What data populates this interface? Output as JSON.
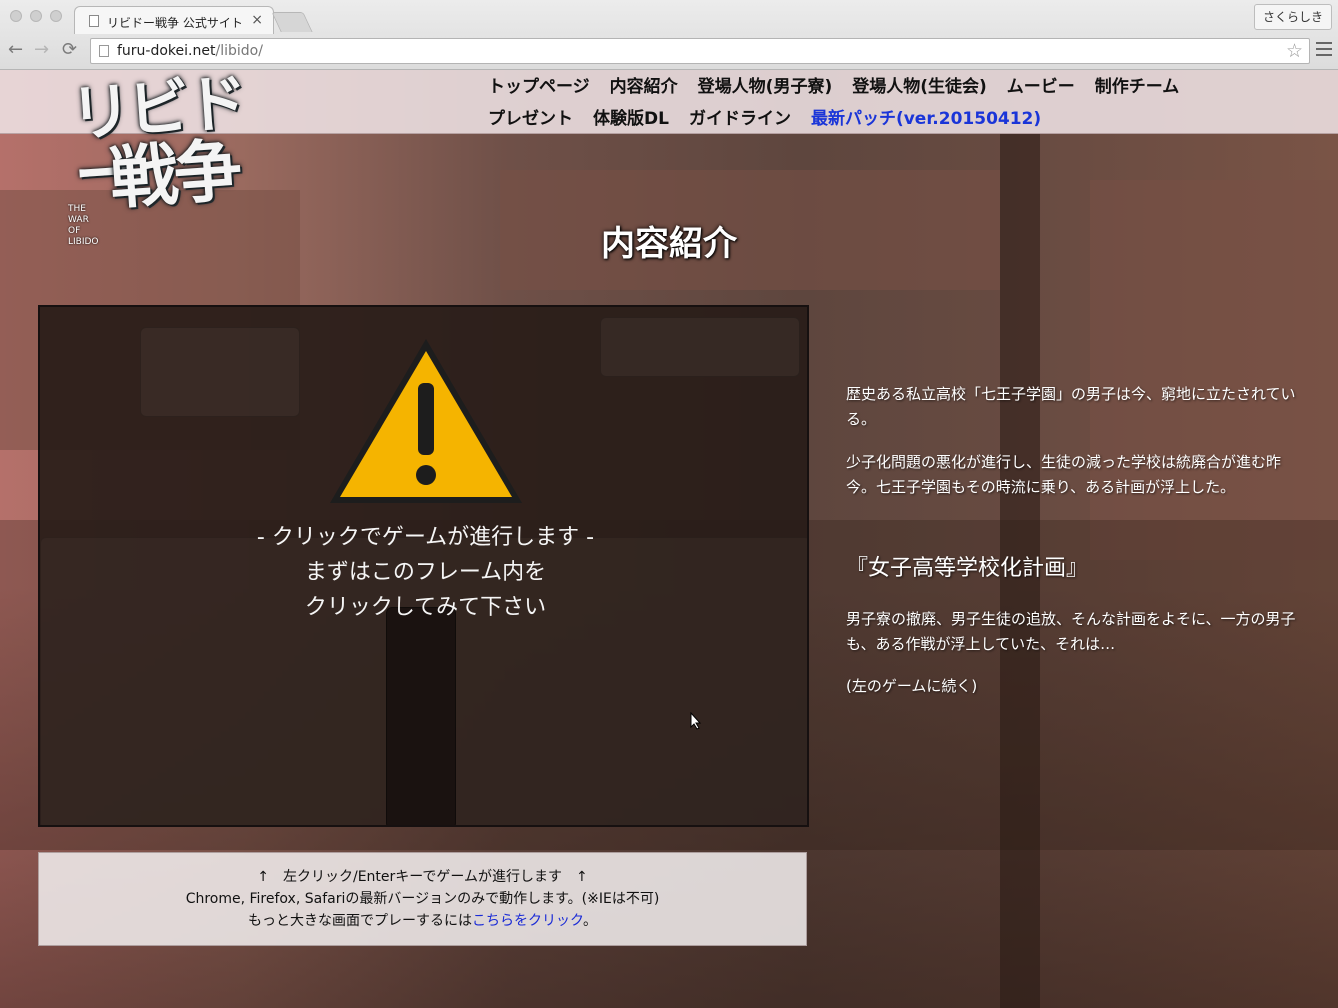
{
  "browser": {
    "tab_title": "リビドー戦争 公式サイト",
    "tab_close": "×",
    "profile_label": "さくらしき",
    "url_host": "furu-dokei.net",
    "url_path": "/libido/",
    "back": "←",
    "forward": "→",
    "reload": "⟳",
    "bookmark_star": "☆"
  },
  "logo": {
    "line1": "リビドー",
    "line2": "戦争",
    "sub": [
      "THE",
      "WAR",
      "OF",
      "LIBIDO"
    ]
  },
  "nav": {
    "row1": [
      "トップページ",
      "内容紹介",
      "登場人物(男子寮)",
      "登場人物(生徒会)",
      "ムービー",
      "制作チーム"
    ],
    "row2": [
      "プレゼント",
      "体験版DL",
      "ガイドライン",
      "最新パッチ(ver.20150412)"
    ]
  },
  "page_title": "内容紹介",
  "game": {
    "line1": "- クリックでゲームが進行します -",
    "line2": "まずはこのフレーム内を",
    "line3": "クリックしてみて下さい",
    "warning_color": "#f5b400"
  },
  "description": {
    "p1": "歴史ある私立高校「七王子学園」の男子は今、窮地に立たされている。",
    "p2": "少子化問題の悪化が進行し、生徒の減った学校は統廃合が進む昨今。七王子学園もその時流に乗り、ある計画が浮上した。",
    "heading": "『女子高等学校化計画』",
    "p3": "男子寮の撤廃、男子生徒の追放、そんな計画をよそに、一方の男子も、ある作戦が浮上していた、それは…",
    "p4": "(左のゲームに続く)"
  },
  "info": {
    "line1": "↑　左クリック/Enterキーでゲームが進行します　↑",
    "line2": "Chrome, Firefox, Safariの最新バージョンのみで動作します。(※IEは不可)",
    "line3_pre": "もっと大きな画面でプレーするには",
    "line3_link": "こちらをクリック",
    "line3_post": "。"
  }
}
